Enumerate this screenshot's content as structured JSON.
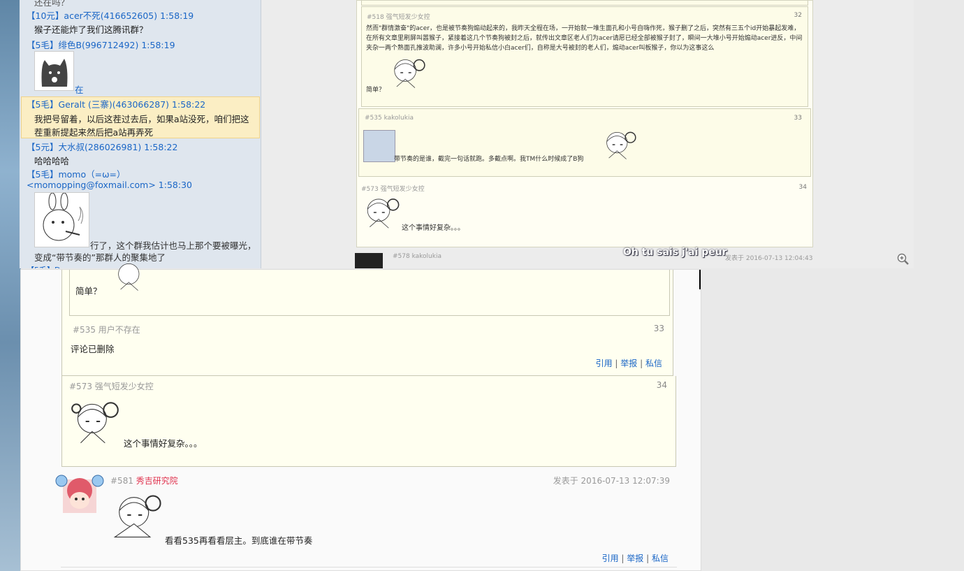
{
  "qq_chat": {
    "messages": [
      {
        "header": "【10元】acer不死(416652605) 1:58:19",
        "body": "猴子还能炸了我们这腾讯群？"
      },
      {
        "header": "【5毛】绯色B(996712492) 1:58:19",
        "body": "在"
      },
      {
        "header": "【5毛】Geralt (三寨)(463066287) 1:58:22",
        "body": "我把号留着，以后这茬过去后，如果a站没死，咱们把这茬重新提起来然后把a站再弄死"
      },
      {
        "header": "【5元】大水叔(286026981) 1:58:22",
        "body": "哈哈哈哈"
      },
      {
        "header": "【5毛】momo（=ω=）<momopping@foxmail.com> 1:58:30",
        "body": "行了，这个群我估计也马上那个要被曝光，变成“带节奏的”那群人的聚集地了"
      }
    ]
  },
  "top_forum": {
    "q518": {
      "floor": "#518 强气短发少女控",
      "index": "32",
      "text": "然而\"群情激奋\"的acer，也是被节奏狗煽动起来的，我昨天全程在场，一开始就一堆生面孔和小号自嗨作死，猴子删了之后，突然有三五个id开始暴起发难，在所有文章里刷屏叫嚣猴子，紧接着这几个节奏狗被封之后，就传出文章区老人们为acer请愿已经全部被猴子封了，瞬间一大堆小号开始煽动acer进反，中间夹杂一两个熟面孔推波助澜，许多小号开始私信小白acer们，自称是大号被封的老人们，煽动acer叫板猴子，你以为这事这么",
      "tail": "简单？"
    },
    "q535": {
      "floor": "#535 kakolukia",
      "index": "33",
      "text": "带节奏的是谁，截完一句话就跑。多截点啊。我TM什么时候成了B狗"
    },
    "q573": {
      "floor": "#573 强气短发少女控",
      "index": "34",
      "text": "这个事情好复杂。。。"
    },
    "p578": {
      "floor": "#578 kakolukia",
      "caption": "Oh tu sais j'ai peur",
      "date": "发表于 2016-07-13 12:04:43"
    }
  },
  "main_forum": {
    "prev_tail": "简单？",
    "q535": {
      "floor": "#535 用户不存在",
      "index": "33",
      "text": "评论已删除",
      "actions": [
        "引用",
        "举报",
        "私信"
      ]
    },
    "q573": {
      "floor": "#573 强气短发少女控",
      "index": "34",
      "text": "这个事情好复杂。。。"
    },
    "p581": {
      "floor_no": "#581",
      "author": "秀吉研究院",
      "date": "发表于 2016-07-13 12:07:39",
      "text": "看看535再看看层主。到底谁在带节奏",
      "actions": [
        "引用",
        "举报",
        "私信"
      ]
    }
  },
  "colors": {
    "link": "#1a66c6",
    "author_pink": "#e0304c",
    "quote_bg": "#fffff0",
    "highlight": "#fbeec4"
  },
  "icons": [
    "zoom-in-icon",
    "cat-sticker",
    "rabbit-sticker",
    "anime-girl-sticker",
    "avatar"
  ]
}
